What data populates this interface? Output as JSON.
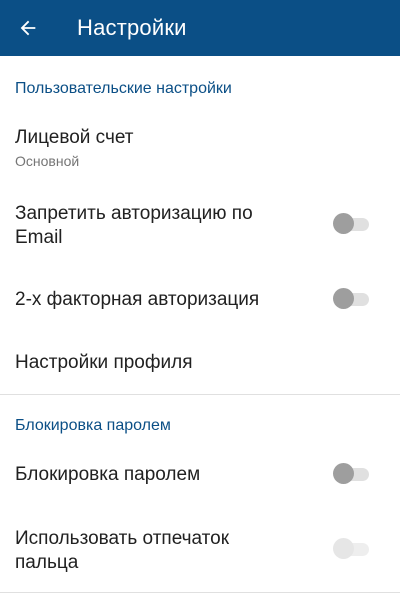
{
  "appbar": {
    "back_icon": "arrow-back-icon",
    "title": "Настройки",
    "background": "#0b4f86"
  },
  "sections": {
    "user": {
      "header": "Пользовательские настройки",
      "account": {
        "title": "Лицевой счет",
        "subtitle": "Основной"
      },
      "forbid_email": {
        "title_line1": "Запретить авторизацию по",
        "title_line2": "Email",
        "enabled": false
      },
      "two_factor": {
        "title": "2-х факторная авторизация",
        "enabled": false
      },
      "profile": {
        "title": "Настройки профиля"
      }
    },
    "lock": {
      "header": "Блокировка паролем",
      "password_lock": {
        "title": "Блокировка паролем",
        "enabled": false
      },
      "fingerprint": {
        "title_line1": "Использовать отпечаток",
        "title_line2": "пальца",
        "enabled": false,
        "disabled": true
      }
    }
  },
  "colors": {
    "accent": "#0b4f86",
    "text_primary": "#212121",
    "text_secondary": "#757575"
  }
}
